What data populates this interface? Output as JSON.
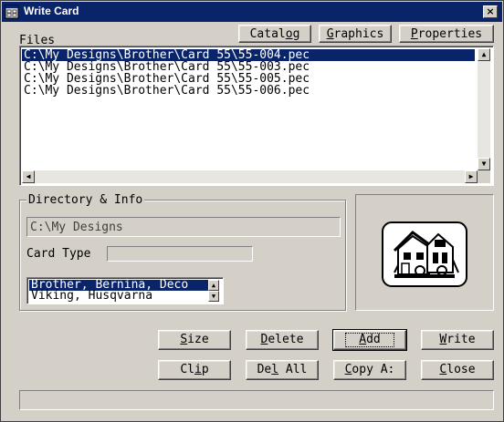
{
  "window": {
    "title": "Write Card",
    "close_label": "×"
  },
  "toolbar": {
    "catalog": {
      "pre": "Catal",
      "key": "o",
      "post": "g"
    },
    "graphics": {
      "pre": "",
      "key": "G",
      "post": "raphics"
    },
    "properties": {
      "pre": "",
      "key": "P",
      "post": "roperties"
    }
  },
  "files": {
    "label": "Files",
    "items": [
      "C:\\My Designs\\Brother\\Card 55\\55-004.pec",
      "C:\\My Designs\\Brother\\Card 55\\55-003.pec",
      "C:\\My Designs\\Brother\\Card 55\\55-005.pec",
      "C:\\My Designs\\Brother\\Card 55\\55-006.pec"
    ],
    "selected_index": 0
  },
  "directory": {
    "group_label": "Directory & Info",
    "path": "C:\\My Designs",
    "card_type_label": "Card Type",
    "card_type_value": "",
    "machines": [
      "Brother, Bernina, Deco",
      "Viking, Husqvarna"
    ],
    "selected_machine": 0
  },
  "buttons": {
    "size": {
      "pre": "",
      "key": "S",
      "post": "ize"
    },
    "delete": {
      "pre": "",
      "key": "D",
      "post": "elete"
    },
    "add": {
      "pre": "",
      "key": "A",
      "post": "dd"
    },
    "write": {
      "pre": "",
      "key": "W",
      "post": "rite"
    },
    "clip": {
      "pre": "Cl",
      "key": "i",
      "post": "p"
    },
    "delall": {
      "pre": "De",
      "key": "l",
      "post": " All"
    },
    "copy": {
      "pre": "",
      "key": "C",
      "post": "opy A:"
    },
    "close": {
      "pre": "",
      "key": "C",
      "post": "lose"
    }
  },
  "status": {
    "text": ""
  }
}
